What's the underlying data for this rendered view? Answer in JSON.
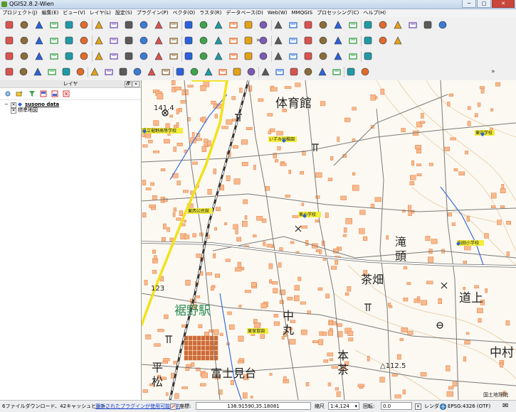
{
  "window": {
    "title": "QGIS2.8.2-Wien",
    "minimize": "─",
    "maximize": "□",
    "close": "✕"
  },
  "menus": [
    "プロジェクト(J)",
    "編集(E)",
    "ビュー(V)",
    "レイヤ(L)",
    "設定(S)",
    "プラグイン(P)",
    "ベクタ(O)",
    "ラスタ(R)",
    "データベース(D)",
    "Web(W)",
    "MMQGIS",
    "プロセッシング(C)",
    "ヘルプ(H)"
  ],
  "toolbars": {
    "row1_icons": [
      "new-project-icon",
      "open-project-icon",
      "save-project-icon",
      "save-as-icon",
      "print-composer-icon",
      "composer-manager-icon",
      "touch-icon",
      "pan-icon",
      "pan-to-selection-icon",
      "zoom-in-icon",
      "zoom-out-icon",
      "zoom-actual-icon",
      "zoom-full-icon",
      "zoom-to-selection-icon",
      "zoom-to-layer-icon",
      "zoom-last-icon",
      "zoom-next-icon",
      "refresh-icon",
      "identify-icon",
      "map-tips-icon",
      "select-icon",
      "deselect-icon",
      "measure-icon",
      "statistics-icon",
      "attribute-table-icon",
      "annotation-icon",
      "bookmark-icon",
      "label-icon",
      "text-annotation-icon",
      "map-decoration-icon"
    ],
    "row2_icons": [
      "edit-pencil-icon",
      "toggle-editing-icon",
      "save-edits-icon",
      "add-feature-icon",
      "move-feature-icon",
      "node-tool-icon",
      "delete-selected-icon",
      "cut-features-icon",
      "copy-features-icon",
      "paste-features-icon",
      "undo-icon",
      "csw-icon",
      "vector-icon",
      "raster-icon",
      "label-tool-icon",
      "pin-label-icon",
      "show-hide-label-icon",
      "move-label-icon",
      "rotate-label-icon",
      "change-label-icon",
      "georef-icon",
      "digitize-icon",
      "plugin-icon",
      "snapping-icon",
      "calculator-icon",
      "python-icon",
      "sum-icon"
    ],
    "row3_icons": [
      "advanced-digitizing-icon",
      "undo-edit-icon",
      "redo-edit-icon",
      "rotate-feature-icon",
      "simplify-icon",
      "add-ring-icon",
      "add-part-icon",
      "fill-ring-icon",
      "delete-ring-icon",
      "delete-part-icon",
      "reshape-icon",
      "offset-curve-icon",
      "split-features-icon",
      "split-parts-icon",
      "merge-features-icon",
      "merge-attributes-icon",
      "rotate-point-icon",
      "spatial-query-icon",
      "point-layer-icon",
      "line-layer-icon",
      "polygon-layer-icon",
      "grid-icon",
      "topology-icon",
      "oracle-icon",
      "edit-style-icon"
    ],
    "row4_icons": [
      "add-vector-icon",
      "add-raster-icon",
      "add-postgis-icon",
      "add-spatialite-icon",
      "add-mssql-icon",
      "add-oracle-icon",
      "add-wms-icon",
      "add-wcs-icon",
      "add-wfs-icon",
      "add-delimited-icon",
      "add-virtual-icon",
      "new-layer-icon",
      "help-icon",
      "python-console-icon",
      "processing-toolbox-icon",
      "model-icon",
      "history-icon",
      "results-icon",
      "commander-icon",
      "options-icon",
      "openlayers-icon",
      "gdal-icon",
      "more-icon",
      "terrain-icon",
      "numeric-icon",
      "data-icon"
    ],
    "more": "»"
  },
  "layers_panel": {
    "title": "レイヤ",
    "float": "🗗",
    "close": "✕",
    "items": [
      {
        "expand": "−",
        "checked": "✕",
        "label": "susono data",
        "bold": true
      },
      {
        "expand": "",
        "checked": "✕",
        "label": "標準地図",
        "bold": false
      }
    ]
  },
  "map": {
    "labels": [
      {
        "text": "体育館",
        "kind": "big"
      },
      {
        "text": "滝",
        "kind": "big"
      },
      {
        "text": "頭",
        "kind": "big"
      },
      {
        "text": "茶畑",
        "kind": "big"
      },
      {
        "text": "道上",
        "kind": "big"
      },
      {
        "text": "中",
        "kind": "big"
      },
      {
        "text": "丸",
        "kind": "big"
      },
      {
        "text": "中村",
        "kind": "big"
      },
      {
        "text": "本",
        "kind": "big"
      },
      {
        "text": "茶",
        "kind": "big"
      },
      {
        "text": "平",
        "kind": "big"
      },
      {
        "text": "松",
        "kind": "big"
      },
      {
        "text": "富士見台",
        "kind": "big"
      },
      {
        "text": "裾野駅",
        "kind": "station"
      },
      {
        "text": "△112.5",
        "kind": "small"
      },
      {
        "text": "141.4",
        "kind": "small"
      },
      {
        "text": "123",
        "kind": "small"
      },
      {
        "text": "国土地理院",
        "kind": "attrib"
      }
    ],
    "highlights": [
      "県立裾野高等学校",
      "いずみ幼稚園",
      "東西公民館",
      "東小学校",
      "向田小学校",
      "東中学校",
      "東保育園"
    ]
  },
  "statusbar": {
    "message": "6ファイルダウンロード、42キャッシュヒット、",
    "plugin_link": "更新されたプラグインが使用可能です",
    "coord_label": "座標:",
    "coord_value": "138.91590,35.18081",
    "scale_label": "縮尺",
    "scale_value": "1:4,124",
    "rotation_label": "回転:",
    "rotation_value": "0.0",
    "render_label": "レンダ",
    "crs": "EPSG:4326 (OTF)",
    "message_icon": "✉"
  }
}
